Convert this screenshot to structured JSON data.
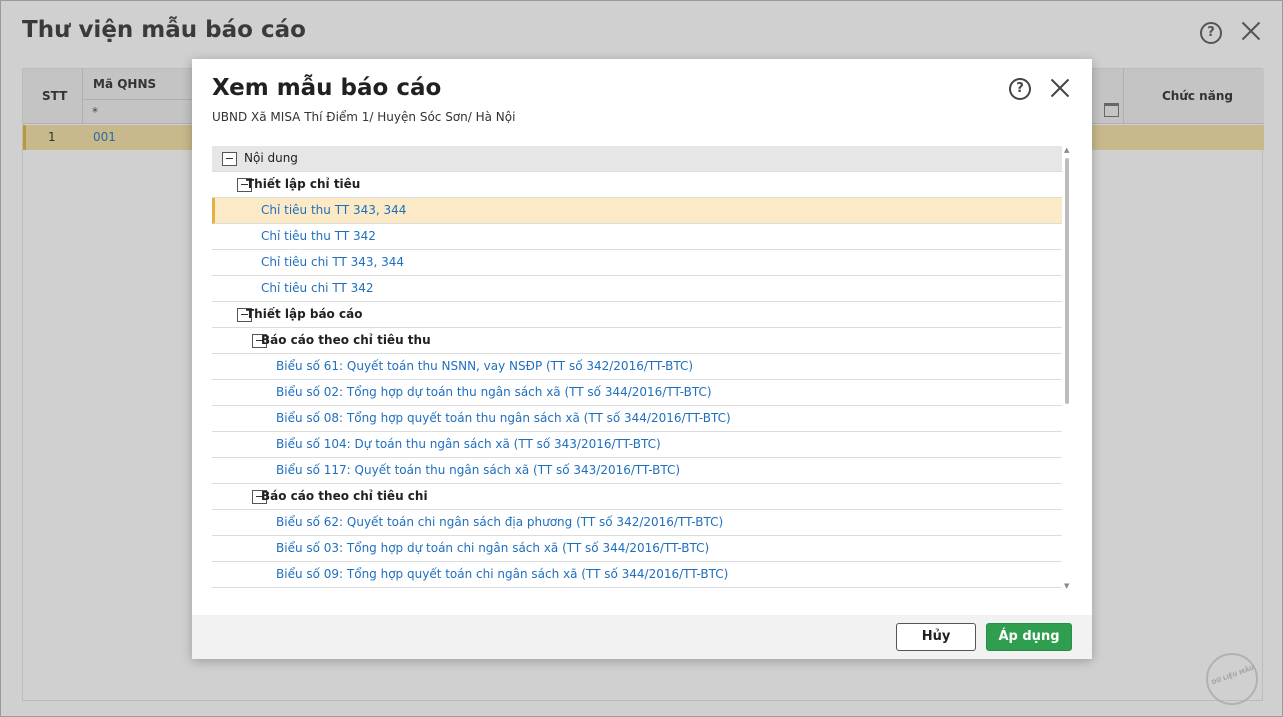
{
  "window": {
    "title": "Thư viện mẫu báo cáo",
    "help_glyph": "?"
  },
  "grid": {
    "headers": {
      "stt": "STT",
      "ma_qhns": "Mã QHNS",
      "chuc_nang": "Chức năng"
    },
    "filter_star": "*",
    "rows": [
      {
        "stt": "1",
        "ma_qhns": "001"
      }
    ]
  },
  "dialog": {
    "title": "Xem mẫu báo cáo",
    "subtitle": "UBND Xã MISA Thí Điểm 1/ Huyện Sóc Sơn/ Hà Nội",
    "help_glyph": "?",
    "tree": [
      {
        "label": "Nội dung",
        "type": "root"
      },
      {
        "label": "Thiết lập chỉ tiêu",
        "type": "group"
      },
      {
        "label": "Chỉ tiêu thu TT 343, 344",
        "type": "leaf",
        "selected": true
      },
      {
        "label": "Chỉ tiêu thu TT 342",
        "type": "leaf"
      },
      {
        "label": "Chỉ tiêu chi TT 343, 344",
        "type": "leaf"
      },
      {
        "label": "Chỉ tiêu chi TT 342",
        "type": "leaf"
      },
      {
        "label": "Thiết lập báo cáo",
        "type": "group"
      },
      {
        "label": "Báo cáo theo chỉ tiêu thu",
        "type": "group"
      },
      {
        "label": "Biểu số 61: Quyết toán thu NSNN, vay NSĐP (TT số 342/2016/TT-BTC)",
        "type": "leaf"
      },
      {
        "label": "Biểu số 02: Tổng hợp dự toán thu ngân sách xã (TT số 344/2016/TT-BTC)",
        "type": "leaf"
      },
      {
        "label": "Biểu số 08: Tổng hợp quyết toán thu ngân sách xã (TT số 344/2016/TT-BTC)",
        "type": "leaf"
      },
      {
        "label": "Biểu số 104: Dự toán thu ngân sách xã (TT số 343/2016/TT-BTC)",
        "type": "leaf"
      },
      {
        "label": "Biểu số 117: Quyết toán thu ngân sách xã (TT số 343/2016/TT-BTC)",
        "type": "leaf"
      },
      {
        "label": "Báo cáo theo chỉ tiêu chi",
        "type": "group"
      },
      {
        "label": "Biểu số 62: Quyết toán chi ngân sách địa phương (TT số 342/2016/TT-BTC)",
        "type": "leaf"
      },
      {
        "label": "Biểu số 03: Tổng hợp dự toán chi ngân sách xã (TT số 344/2016/TT-BTC)",
        "type": "leaf"
      },
      {
        "label": "Biểu số 09: Tổng hợp quyết toán chi ngân sách xã (TT số 344/2016/TT-BTC)",
        "type": "leaf"
      }
    ],
    "buttons": {
      "cancel": "Hủy",
      "apply": "Áp dụng"
    }
  },
  "watermark": "DỮ LIỆU MẪU",
  "colors": {
    "accent_green": "#2f9e4f",
    "link_blue": "#1f6fbf",
    "selected_row": "#fbeac5"
  }
}
